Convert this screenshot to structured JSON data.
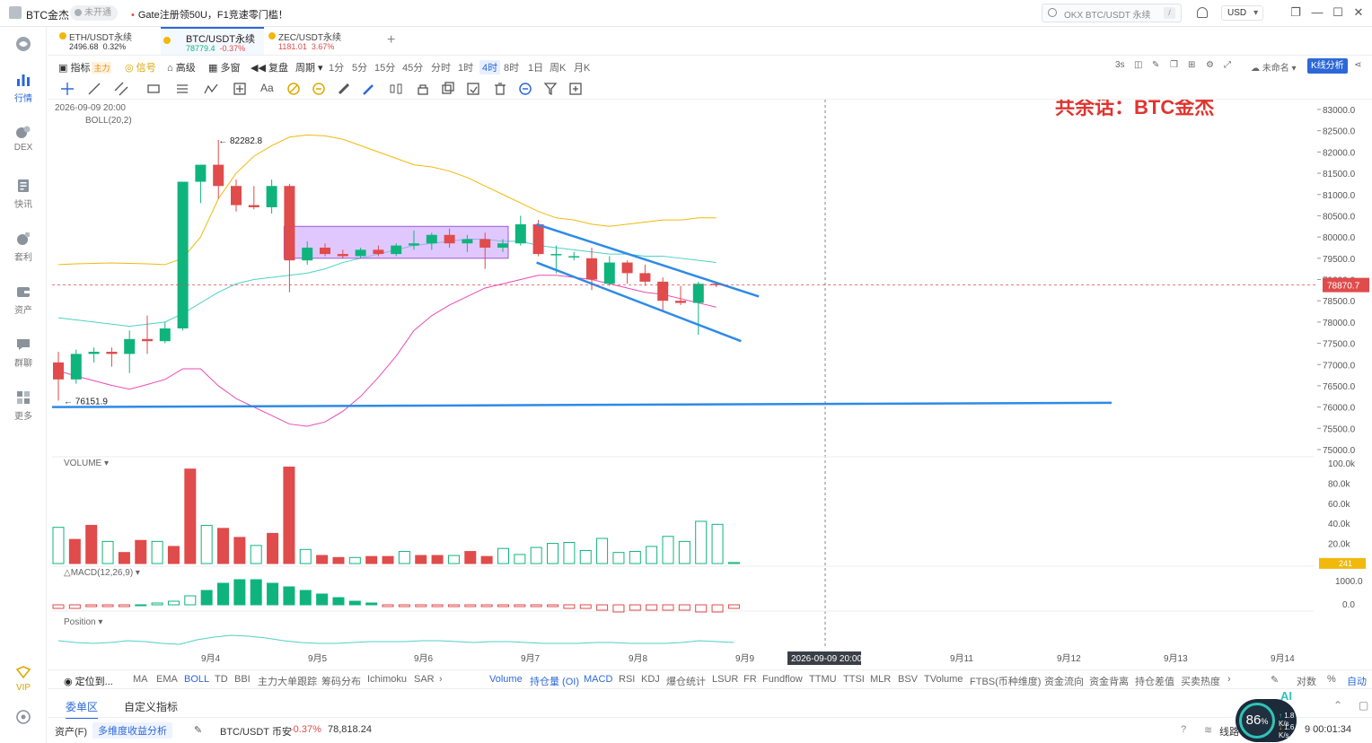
{
  "titlebar": {
    "app_name": "BTC金杰",
    "badge": "未开通",
    "promo": "Gate注册领50U，F1竞速零门槛！",
    "search_placeholder": "OKX BTC/USDT 永续",
    "search_key": "/",
    "currency": "USD",
    "icons": [
      "user-icon",
      "bell-icon",
      "minimize-icon",
      "maximize-icon",
      "close-icon"
    ]
  },
  "sidebar": {
    "items": [
      {
        "label": "",
        "icon": "logo-icon"
      },
      {
        "label": "行情",
        "icon": "chart-bars-icon",
        "active": true
      },
      {
        "label": "DEX",
        "icon": "dex-icon"
      },
      {
        "label": "快讯",
        "icon": "news-icon"
      },
      {
        "label": "套利",
        "icon": "arbitrage-icon"
      },
      {
        "label": "资产",
        "icon": "wallet-icon"
      },
      {
        "label": "群聊",
        "icon": "chat-icon"
      },
      {
        "label": "更多",
        "icon": "grid-icon"
      },
      {
        "label": "VIP",
        "icon": "vip-icon"
      },
      {
        "label": "",
        "icon": "settings-icon"
      }
    ]
  },
  "tabs": [
    {
      "name": "ETH/USDT永续",
      "price": "2496.68",
      "change": "0.32%",
      "dir": "pos"
    },
    {
      "name": "BTC/USDT永续",
      "price": "78779.4",
      "change": "-0.37%",
      "dir": "pos-neg",
      "active": true
    },
    {
      "name": "ZEC/USDT永续",
      "price": "1181.01",
      "change": "3.67%",
      "dir": "neg"
    }
  ],
  "toolbar": {
    "indicator": "指标",
    "indicator_tag": "主力",
    "signal": "信号",
    "advanced": "高级",
    "multi": "多窗",
    "replay": "复盘",
    "period": "周期",
    "periods": [
      "1分",
      "5分",
      "15分",
      "45分",
      "分时",
      "1时",
      "4时",
      "8时",
      "1日",
      "周K",
      "月K"
    ],
    "active_period": "4时",
    "interval": "3s",
    "layout_name": "未命名",
    "kline_analysis": "K线分析"
  },
  "chart_data": {
    "type": "candlestick",
    "title": "共余话：BTC金杰",
    "timestamp": "2026-09-09 20:00",
    "indicator": "BOLL(20,2)",
    "high_label": "82282.8",
    "low_label": "76151.9",
    "last_price": "78870.7",
    "y_ticks": [
      "83000.0",
      "82500.0",
      "82000.0",
      "81500.0",
      "81000.0",
      "80500.0",
      "80000.0",
      "79500.0",
      "79000.0",
      "78500.0",
      "78000.0",
      "77500.0",
      "77000.0",
      "76500.0",
      "76000.0",
      "75500.0",
      "75000.0"
    ],
    "x_ticks": [
      "9月4",
      "9月5",
      "9月6",
      "9月7",
      "9月8",
      "9月9",
      "9月10",
      "9月11",
      "9月12",
      "9月13",
      "9月14"
    ],
    "crosshair_date": "2026-09-09 20:00",
    "ylim": [
      75000,
      83000
    ],
    "candles": [
      {
        "o": 77050,
        "h": 77300,
        "l": 76150,
        "c": 76650
      },
      {
        "o": 76650,
        "h": 77350,
        "l": 76550,
        "c": 77250
      },
      {
        "o": 77250,
        "h": 77400,
        "l": 77050,
        "c": 77300
      },
      {
        "o": 77300,
        "h": 77400,
        "l": 76950,
        "c": 77250
      },
      {
        "o": 77250,
        "h": 77800,
        "l": 76800,
        "c": 77600
      },
      {
        "o": 77600,
        "h": 78150,
        "l": 77250,
        "c": 77550
      },
      {
        "o": 77550,
        "h": 78000,
        "l": 77500,
        "c": 77850
      },
      {
        "o": 77850,
        "h": 81300,
        "l": 77800,
        "c": 81300
      },
      {
        "o": 81300,
        "h": 81700,
        "l": 80800,
        "c": 81700
      },
      {
        "o": 81700,
        "h": 82283,
        "l": 80900,
        "c": 81200
      },
      {
        "o": 81200,
        "h": 81350,
        "l": 80600,
        "c": 80750
      },
      {
        "o": 80750,
        "h": 81200,
        "l": 80650,
        "c": 80700
      },
      {
        "o": 80700,
        "h": 81350,
        "l": 80550,
        "c": 81200
      },
      {
        "o": 81200,
        "h": 81250,
        "l": 78700,
        "c": 79450
      },
      {
        "o": 79450,
        "h": 79900,
        "l": 79350,
        "c": 79750
      },
      {
        "o": 79750,
        "h": 79850,
        "l": 79550,
        "c": 79600
      },
      {
        "o": 79600,
        "h": 79700,
        "l": 79500,
        "c": 79550
      },
      {
        "o": 79550,
        "h": 79750,
        "l": 79500,
        "c": 79700
      },
      {
        "o": 79700,
        "h": 79800,
        "l": 79550,
        "c": 79600
      },
      {
        "o": 79600,
        "h": 79850,
        "l": 79550,
        "c": 79800
      },
      {
        "o": 79800,
        "h": 80150,
        "l": 79700,
        "c": 79850
      },
      {
        "o": 79850,
        "h": 80100,
        "l": 79700,
        "c": 80050
      },
      {
        "o": 80050,
        "h": 80200,
        "l": 79750,
        "c": 79850
      },
      {
        "o": 79850,
        "h": 80050,
        "l": 79650,
        "c": 79950
      },
      {
        "o": 79950,
        "h": 80100,
        "l": 79250,
        "c": 79750
      },
      {
        "o": 79750,
        "h": 79950,
        "l": 79650,
        "c": 79850
      },
      {
        "o": 79850,
        "h": 80500,
        "l": 79800,
        "c": 80300
      },
      {
        "o": 80300,
        "h": 80400,
        "l": 79550,
        "c": 79600
      },
      {
        "o": 79600,
        "h": 79800,
        "l": 79150,
        "c": 79600
      },
      {
        "o": 79550,
        "h": 79650,
        "l": 79450,
        "c": 79550
      },
      {
        "o": 79500,
        "h": 79750,
        "l": 78750,
        "c": 79000
      },
      {
        "o": 78900,
        "h": 79550,
        "l": 78850,
        "c": 79400
      },
      {
        "o": 79400,
        "h": 79450,
        "l": 78900,
        "c": 79150
      },
      {
        "o": 79150,
        "h": 79350,
        "l": 78850,
        "c": 78950
      },
      {
        "o": 78950,
        "h": 79050,
        "l": 78250,
        "c": 78500
      },
      {
        "o": 78500,
        "h": 78850,
        "l": 78400,
        "c": 78450
      },
      {
        "o": 78450,
        "h": 78950,
        "l": 77700,
        "c": 78900
      },
      {
        "o": 78900,
        "h": 78930,
        "l": 78820,
        "c": 78871
      }
    ],
    "boll_upper": [
      79350,
      79370,
      79380,
      79390,
      79380,
      79370,
      79350,
      79500,
      80000,
      80900,
      81500,
      81900,
      82150,
      82350,
      82400,
      82380,
      82300,
      82150,
      82000,
      81850,
      81700,
      81650,
      81550,
      81400,
      81200,
      81000,
      80800,
      80600,
      80450,
      80400,
      80300,
      80250,
      80300,
      80350,
      80400,
      80400,
      80450,
      80450
    ],
    "boll_mid": [
      78100,
      78050,
      78000,
      77950,
      77900,
      77950,
      78000,
      78200,
      78450,
      78700,
      78900,
      79000,
      79050,
      79100,
      79150,
      79250,
      79400,
      79500,
      79600,
      79700,
      79800,
      79850,
      79900,
      79950,
      79950,
      79900,
      79900,
      79800,
      79750,
      79700,
      79650,
      79600,
      79600,
      79550,
      79550,
      79500,
      79450,
      79400
    ],
    "boll_lower": [
      76850,
      76730,
      76620,
      76510,
      76420,
      76530,
      76650,
      76900,
      76900,
      76500,
      76200,
      76000,
      75800,
      75600,
      75550,
      75650,
      75900,
      76250,
      76700,
      77200,
      77800,
      78150,
      78400,
      78600,
      78800,
      78900,
      79000,
      79100,
      79100,
      79050,
      79000,
      78900,
      78800,
      78700,
      78650,
      78550,
      78450,
      78350
    ],
    "volume": {
      "label": "VOLUME",
      "y_ticks": [
        "100.0k",
        "80.0k",
        "60.0k",
        "40.0k",
        "20.0k"
      ],
      "last_label": "241",
      "values": [
        36000,
        24000,
        38000,
        22000,
        11000,
        23000,
        22000,
        17000,
        94000,
        38000,
        35000,
        26000,
        18000,
        30000,
        96000,
        14000,
        8000,
        6000,
        6000,
        7000,
        7000,
        12000,
        8000,
        8000,
        8000,
        12000,
        7000,
        15000,
        9000,
        16000,
        20000,
        21000,
        13000,
        25000,
        11000,
        12000,
        17000,
        27000,
        22000,
        42000,
        39000,
        1000
      ]
    },
    "macd": {
      "label": "MACD(12,26,9)",
      "y_ticks": [
        "1000.0",
        "0.0"
      ]
    },
    "position": {
      "label": "Position"
    }
  },
  "indicator_bar": {
    "locate": "定位到...",
    "main_indicators": [
      "MA",
      "EMA",
      "BOLL",
      "TD",
      "BBI",
      "主力大单跟踪",
      "筹码分布",
      "Ichimoku",
      "SAR"
    ],
    "active_main": "BOLL",
    "sub_indicators": [
      "Volume",
      "持仓量 (OI)",
      "MACD",
      "RSI",
      "KDJ",
      "爆仓统计",
      "LSUR",
      "FR",
      "Fundflow",
      "TTMU",
      "TTSI",
      "MLR",
      "BSV",
      "TVolume",
      "FTBS(币种维度)",
      "资金流向",
      "资金背离",
      "持仓差值",
      "买卖热度"
    ],
    "active_sub": [
      "Volume",
      "持仓量 (OI)",
      "MACD"
    ],
    "right": [
      "对数",
      "自动"
    ]
  },
  "bottom": {
    "tabs": [
      "委单区",
      "自定义指标"
    ],
    "asset_label": "资产(F)",
    "analysis_label": "多维度收益分析",
    "pair": "BTC/USDT 币安",
    "pair_change": "-0.37%",
    "pair_price": "78,818.24",
    "net_label": "线路",
    "clock": "9 00:01:34"
  },
  "net_widget": {
    "percent": "86",
    "percent_unit": "%",
    "up": "1.8 K/s",
    "down": "1.6 K/s",
    "ai": "AI"
  },
  "colors": {
    "up": "#0fb47c",
    "down": "#e04b4b",
    "accent": "#2d68d8",
    "boll_upper": "#f0b90b",
    "boll_mid": "#4fd1c5",
    "boll_lower": "#e84bb5",
    "range_box": "#c79bff"
  }
}
